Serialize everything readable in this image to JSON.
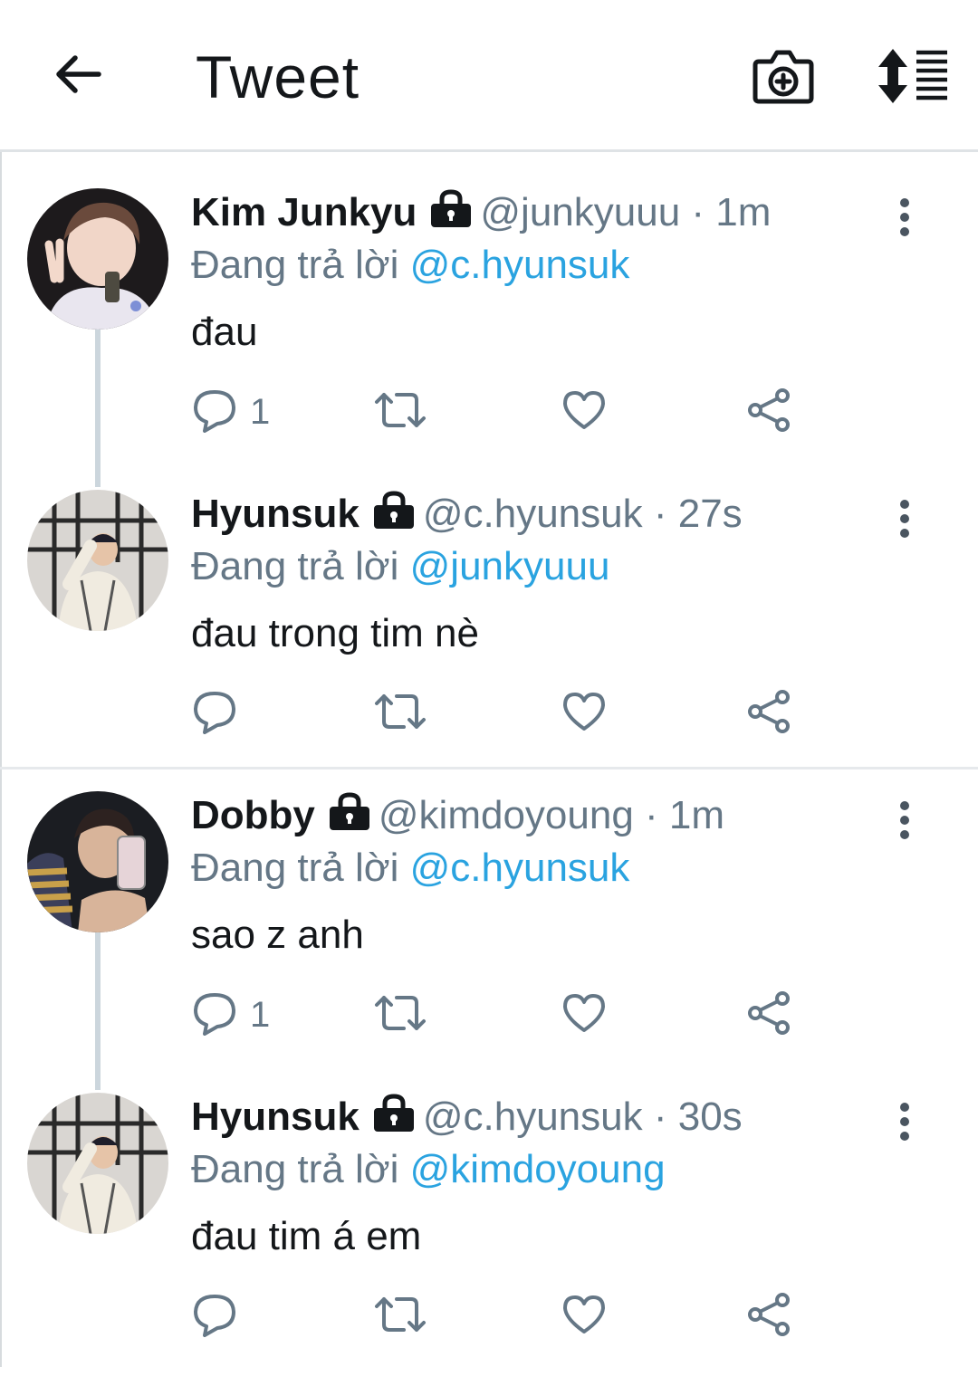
{
  "header": {
    "title": "Tweet"
  },
  "colors": {
    "accent": "#2aa3e0",
    "secondary_text": "#657786",
    "icon": "#657786",
    "divider": "#e6e9ec"
  },
  "icons": {
    "back": "arrow-left-icon",
    "camera": "camera-plus-icon",
    "sort": "sort-order-icon",
    "lock": "lock-icon",
    "more": "more-vertical-icon",
    "reply": "reply-bubble-icon",
    "retweet": "retweet-icon",
    "like": "heart-icon",
    "share": "share-icon"
  },
  "threads": [
    {
      "tweets": [
        {
          "name": "Kim Junkyu",
          "handle": "@junkyuuu",
          "time": "1m",
          "replying_prefix": "Đang trả lời",
          "replying_to": "@c.hyunsuk",
          "text": "đau",
          "reply_count": "1"
        },
        {
          "name": "Hyunsuk",
          "handle": "@c.hyunsuk",
          "time": "27s",
          "replying_prefix": "Đang trả lời",
          "replying_to": "@junkyuuu",
          "text": "đau trong tim nè",
          "reply_count": ""
        }
      ]
    },
    {
      "tweets": [
        {
          "name": "Dobby",
          "handle": "@kimdoyoung",
          "time": "1m",
          "replying_prefix": "Đang trả lời",
          "replying_to": "@c.hyunsuk",
          "text": "sao z anh",
          "reply_count": "1"
        },
        {
          "name": "Hyunsuk",
          "handle": "@c.hyunsuk",
          "time": "30s",
          "replying_prefix": "Đang trả lời",
          "replying_to": "@kimdoyoung",
          "text": "đau tim á em",
          "reply_count": ""
        }
      ]
    }
  ]
}
